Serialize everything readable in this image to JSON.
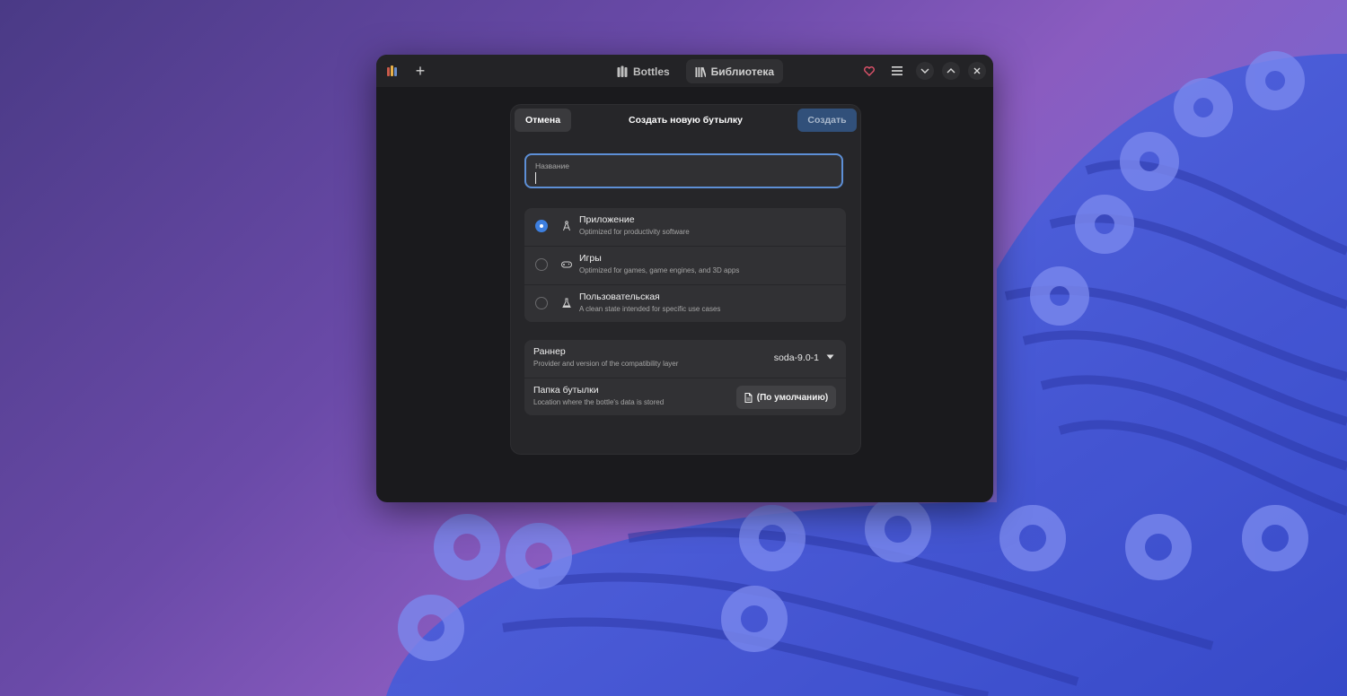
{
  "titlebar": {
    "tabs": [
      {
        "label": "Bottles",
        "icon": "bottles-icon",
        "active": false
      },
      {
        "label": "Библиотека",
        "icon": "library-icon",
        "active": true
      }
    ],
    "icons": {
      "app": "bottles-app-icon",
      "add": "plus-icon",
      "donate": "heart-icon",
      "menu": "hamburger-menu-icon",
      "minimize": "chevron-down-icon",
      "maximize": "chevron-up-icon",
      "close": "close-icon"
    }
  },
  "dialog": {
    "title": "Создать новую бутылку",
    "cancel_label": "Отмена",
    "create_label": "Создать",
    "name_field": {
      "label": "Название",
      "value": ""
    },
    "environments": [
      {
        "title": "Приложение",
        "subtitle": "Optimized for productivity software",
        "icon": "compass-icon",
        "selected": true
      },
      {
        "title": "Игры",
        "subtitle": "Optimized for games, game engines, and 3D apps",
        "icon": "gamepad-icon",
        "selected": false
      },
      {
        "title": "Пользовательская",
        "subtitle": "A clean state intended for specific use cases",
        "icon": "flask-icon",
        "selected": false
      }
    ],
    "runner": {
      "title": "Раннер",
      "subtitle": "Provider and version of the compatibility layer",
      "value": "soda-9.0-1"
    },
    "folder": {
      "title": "Папка бутылки",
      "subtitle": "Location where the bottle's data is stored",
      "button_label": "(По умолчанию)"
    }
  },
  "colors": {
    "accent": "#3d7fdf",
    "create_button": "#31507a",
    "focus_border": "#5d8fd6",
    "heart": "#e0536b"
  }
}
